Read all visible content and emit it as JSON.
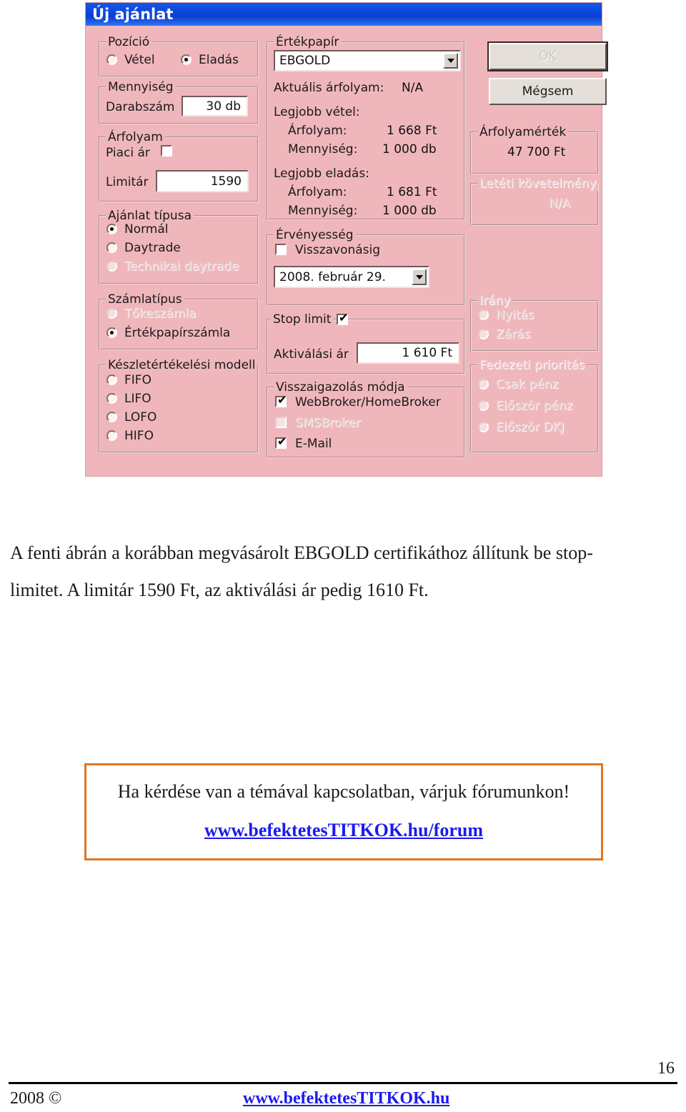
{
  "dialog": {
    "title": "Új ajánlat",
    "buttons": {
      "ok": "OK",
      "cancel": "Mégsem"
    },
    "position": {
      "legend": "Pozíció",
      "options": [
        {
          "label": "Vétel",
          "selected": false
        },
        {
          "label": "Eladás",
          "selected": true
        }
      ]
    },
    "quantity": {
      "legend": "Mennyiség",
      "label": "Darabszám",
      "value": "30 db"
    },
    "price": {
      "legend": "Árfolyam",
      "market_label": "Piaci ár",
      "market_checked": false,
      "limit_label": "Limitár",
      "limit_value": "1590"
    },
    "order_type": {
      "legend": "Ajánlat típusa",
      "options": [
        {
          "label": "Normál",
          "selected": true,
          "disabled": false
        },
        {
          "label": "Daytrade",
          "selected": false,
          "disabled": false
        },
        {
          "label": "Technikai daytrade",
          "selected": false,
          "disabled": true
        }
      ]
    },
    "account_type": {
      "legend": "Számlatípus",
      "options": [
        {
          "label": "Tőkeszámla",
          "selected": false,
          "disabled": true
        },
        {
          "label": "Értékpapírszámla",
          "selected": true,
          "disabled": false
        }
      ]
    },
    "inventory_model": {
      "legend": "Készletértékelési modell",
      "options": [
        {
          "label": "FIFO",
          "selected": false
        },
        {
          "label": "LIFO",
          "selected": false
        },
        {
          "label": "LOFO",
          "selected": false
        },
        {
          "label": "HIFO",
          "selected": false
        }
      ]
    },
    "security": {
      "legend": "Értékpapír",
      "selected": "EBGOLD",
      "current_price_label": "Aktuális árfolyam:",
      "current_price_value": "N/A",
      "best_buy_label": "Legjobb vétel:",
      "best_buy_price_label": "Árfolyam:",
      "best_buy_price_value": "1 668 Ft",
      "best_buy_qty_label": "Mennyiség:",
      "best_buy_qty_value": "1 000 db",
      "best_sell_label": "Legjobb eladás:",
      "best_sell_price_label": "Árfolyam:",
      "best_sell_price_value": "1 681 Ft",
      "best_sell_qty_label": "Mennyiség:",
      "best_sell_qty_value": "1 000 db"
    },
    "validity": {
      "legend": "Érvényesség",
      "until_cancel_label": "Visszavonásig",
      "until_cancel_checked": false,
      "date_value": "2008.    február    29."
    },
    "stop_limit": {
      "legend": "Stop limit",
      "checked": true,
      "activation_label": "Aktiválási ár",
      "activation_value": "1 610 Ft"
    },
    "confirmation": {
      "legend": "Visszaigazolás módja",
      "options": [
        {
          "label": "WebBroker/HomeBroker",
          "checked": true,
          "disabled": false
        },
        {
          "label": "SMSBroker",
          "checked": false,
          "disabled": true
        },
        {
          "label": "E-Mail",
          "checked": true,
          "disabled": false
        }
      ]
    },
    "order_value": {
      "legend": "Árfolyamérték",
      "value": "47 700 Ft"
    },
    "margin_requirement": {
      "legend": "Letéti követelmény",
      "value": "N/A",
      "disabled": true
    },
    "direction": {
      "legend": "Irány",
      "disabled": true,
      "options": [
        {
          "label": "Nyitás",
          "selected": false
        },
        {
          "label": "Zárás",
          "selected": false
        }
      ]
    },
    "collateral_priority": {
      "legend": "Fedezeti prioritás",
      "disabled": true,
      "options": [
        {
          "label": "Csak pénz",
          "selected": false
        },
        {
          "label": "Először pénz",
          "selected": false
        },
        {
          "label": "Először DKJ",
          "selected": false
        }
      ]
    }
  },
  "document": {
    "paragraph_line1": "A fenti ábrán a korábban megvásárolt EBGOLD certifikáthoz állítunk be stop-",
    "paragraph_line2": "limitet. A limitár 1590 Ft, az aktiválási ár pedig 1610 Ft.",
    "callout_line1": "Ha kérdése van a témával kapcsolatban, várjuk fórumunkon!",
    "callout_link": "www.befektetesTITKOK.hu/forum",
    "page_number": "16",
    "footer_year": "2008 ©",
    "footer_link": "www.befektetesTITKOK.hu"
  },
  "colors": {
    "dialog_background": "#efb7bc",
    "titlebar": "#0b46dc",
    "callout_border": "#e2761f",
    "link": "#1a1aee"
  }
}
